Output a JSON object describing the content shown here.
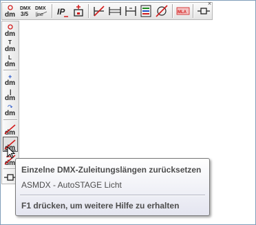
{
  "toolbar_top": {
    "close_glyph": "×",
    "buttons": [
      {
        "icon": "dm-circle-icon",
        "caption": "dm"
      },
      {
        "icon": "dmx-35-icon",
        "top": "DMX",
        "bottom": "3/5"
      },
      {
        "icon": "dmx-line-icon",
        "top": "DMX",
        "bottom": "line"
      },
      {
        "icon": "ip-icon",
        "caption": "IP"
      },
      {
        "icon": "socket-plus-icon"
      },
      {
        "icon": "line-strike-icon"
      },
      {
        "icon": "length-horizontal-icon"
      },
      {
        "icon": "length-bracket-icon"
      },
      {
        "icon": "color-sort-icon"
      },
      {
        "icon": "cable-cross-icon"
      },
      {
        "icon": "mla-icon",
        "caption": "MLA"
      },
      {
        "icon": "connector-icon"
      }
    ]
  },
  "toolbar_side": {
    "buttons": [
      {
        "icon": "dm-circle-icon",
        "caption": "dm"
      },
      {
        "icon": "dm-t-icon",
        "caption": "dm",
        "mark": "T"
      },
      {
        "icon": "dm-l-icon",
        "caption": "dm",
        "mark": "L"
      },
      {
        "icon": "dm-plus-icon",
        "caption": "dm",
        "mark": "+"
      },
      {
        "icon": "dm-bar-icon",
        "caption": "dm",
        "mark": "|"
      },
      {
        "icon": "dm-arrow-icon",
        "caption": "dm",
        "mark": "↷"
      },
      {
        "icon": "dm-strike-icon",
        "caption": "dm"
      },
      {
        "icon": "dm-reset-icon",
        "caption": "dm"
      },
      {
        "icon": "dm-cross-icon",
        "caption": "dm"
      },
      {
        "icon": "connector-icon"
      }
    ]
  },
  "tooltip": {
    "title": "Einzelne DMX-Zuleitungslängen zurücksetzen",
    "body": "ASMDX - AutoSTAGE Licht",
    "help": "F1 drücken, um weitere Hilfe zu erhalten"
  },
  "colors": {
    "accent_red": "#d21a1a",
    "tooltip_border": "#767676",
    "frame_border": "#7f9db9"
  }
}
